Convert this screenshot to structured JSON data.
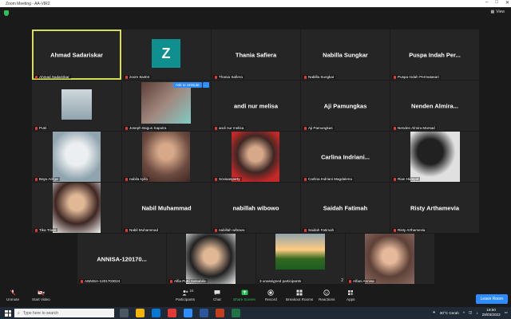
{
  "window": {
    "title": "Zoom Meeting - AA-VIR2",
    "view_label": "View"
  },
  "participants": [
    {
      "name": "Ahmad Sadariskar",
      "label": "Ahmad Sadariskar",
      "active": true
    },
    {
      "name": "Z",
      "label": "zoom 8a404"
    },
    {
      "name": "Thania Safiera",
      "label": "Thania Safiera"
    },
    {
      "name": "Nabilla Sungkar",
      "label": "Nabilla Sungkar"
    },
    {
      "name": "Puspa Indah Per...",
      "label": "Puspa Indah Permatasari"
    },
    {
      "name": "",
      "label": "Putri"
    },
    {
      "name": "",
      "label": "Joseph Bagus Saputra"
    },
    {
      "name": "andi nur melisa",
      "label": "andi nur melisa"
    },
    {
      "name": "Aji Pamungkas",
      "label": "Aji Pamungkas"
    },
    {
      "name": "Nenden  Almira...",
      "label": "Nenden Almira Marsad"
    },
    {
      "name": "",
      "label": "Bayu Arifga"
    },
    {
      "name": "",
      "label": "nabila syifa"
    },
    {
      "name": "",
      "label": "Soviaasparty"
    },
    {
      "name": "Carlina  Indriani...",
      "label": "Carlina Indriani Magdalena"
    },
    {
      "name": "",
      "label": "Rian Hidayat"
    },
    {
      "name": "",
      "label": "Tika Triani"
    },
    {
      "name": "Nabil Muhammad",
      "label": "Nabil Muhammad"
    },
    {
      "name": "nabillah wibowo",
      "label": "nabillah wibowo"
    },
    {
      "name": "Saidah Fatimah",
      "label": "Saidah Fatimah"
    },
    {
      "name": "Risty Arthamevia",
      "label": "Risty Arthamevia"
    },
    {
      "name": "ANNISA-120170...",
      "label": "ANNISA-1201703024"
    },
    {
      "name": "",
      "label": "Alfia Putri Salsabila"
    },
    {
      "name": "",
      "label": "3 unassigned participants",
      "count": "2"
    },
    {
      "name": "",
      "label": "Alfani Annisa"
    }
  ],
  "ask": {
    "button": "Ask to Unmute",
    "more": "..."
  },
  "toolbar": {
    "unmute": "Unmute",
    "start_video": "Start Video",
    "participants": "Participants",
    "participants_count": "24",
    "chat": "Chat",
    "share_screen": "Share Screen",
    "record": "Record",
    "breakout": "Breakout Rooms",
    "reactions": "Reactions",
    "apps": "Apps",
    "leave": "Leave Room"
  },
  "taskbar": {
    "search_placeholder": "Type here to search",
    "weather": "30°C  Cerah",
    "time": "18:50",
    "date": "28/03/2022"
  },
  "colors": {
    "active_outline": "#d4e157",
    "share_green": "#2ec05b",
    "zoom_blue": "#2d8cff",
    "avatar_teal": "#0f8f90"
  }
}
